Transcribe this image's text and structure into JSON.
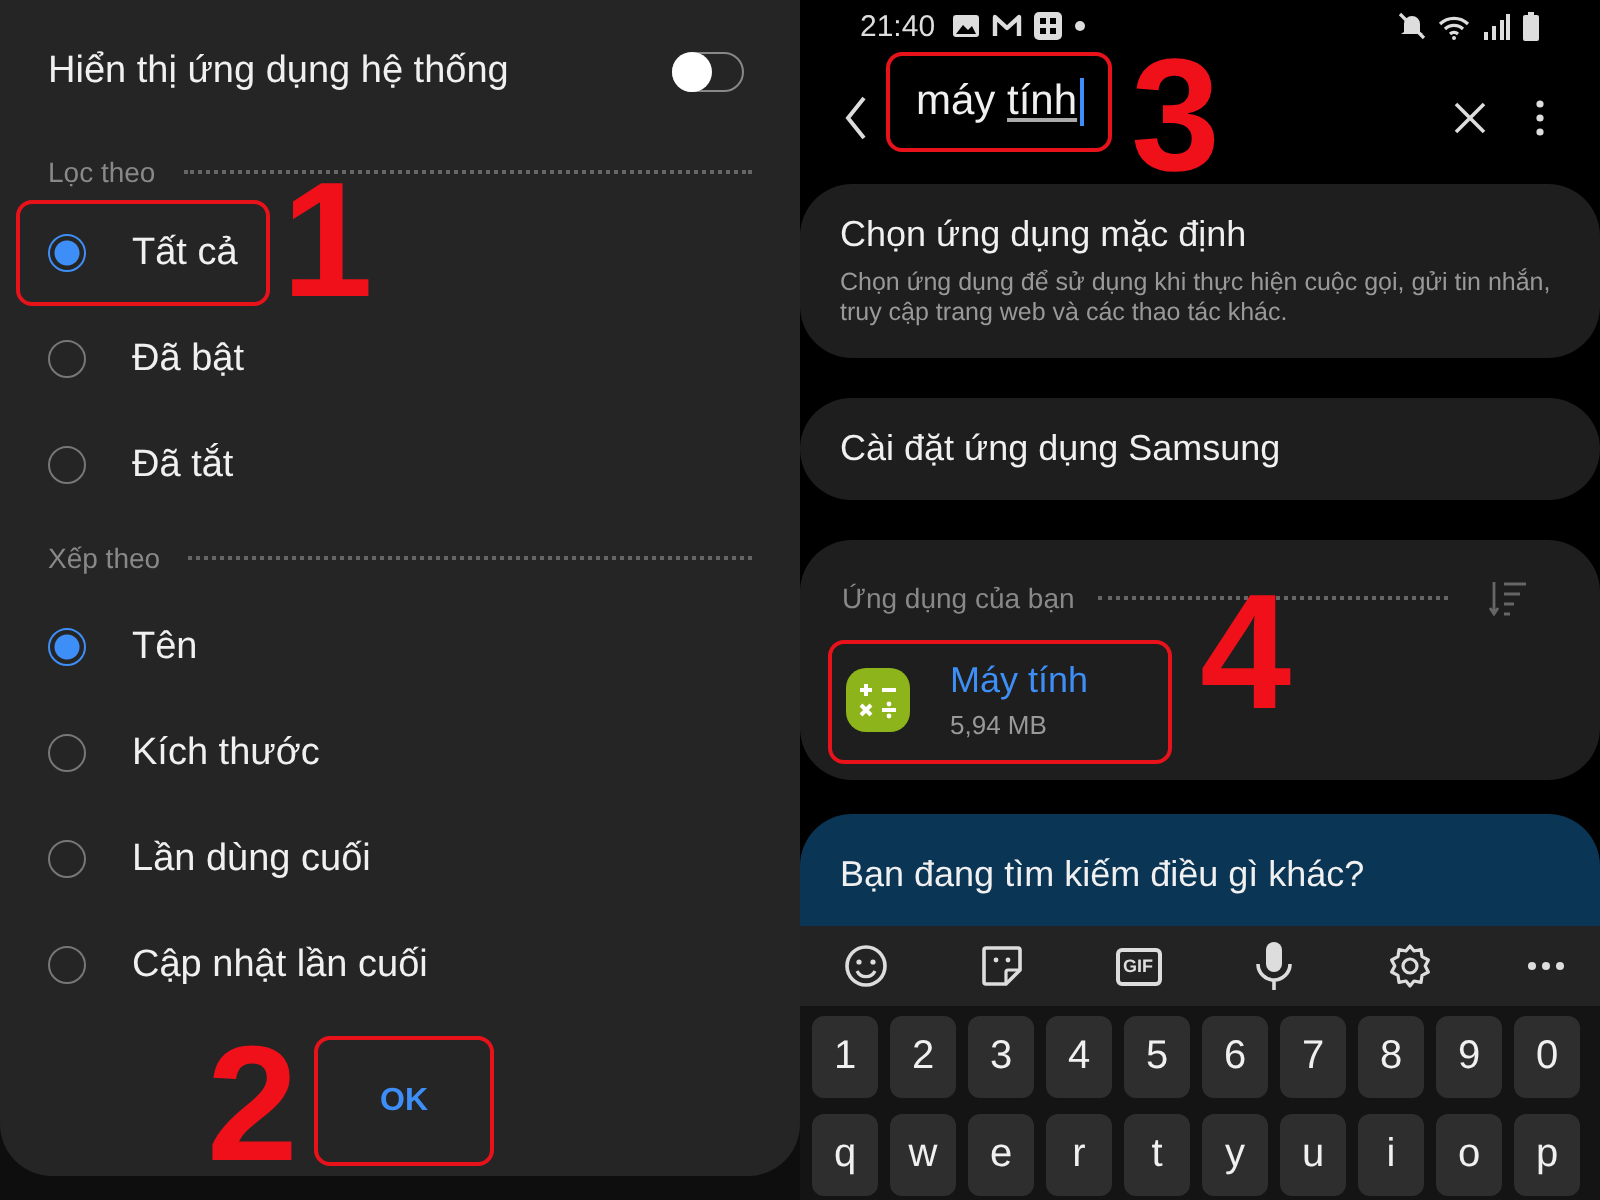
{
  "left": {
    "system_apps": {
      "label": "Hiển thị ứng dụng hệ thống",
      "on": false
    },
    "filter": {
      "title": "Lọc theo",
      "options": [
        {
          "label": "Tất cả",
          "selected": true,
          "callout": "1"
        },
        {
          "label": "Đã bật",
          "selected": false
        },
        {
          "label": "Đã tắt",
          "selected": false
        }
      ]
    },
    "sort": {
      "title": "Xếp theo",
      "options": [
        {
          "label": "Tên",
          "selected": true
        },
        {
          "label": "Kích thước",
          "selected": false
        },
        {
          "label": "Lần dùng cuối",
          "selected": false
        },
        {
          "label": "Cập nhật lần cuối",
          "selected": false
        }
      ]
    },
    "ok_button": {
      "label": "OK",
      "callout": "2"
    }
  },
  "right": {
    "status_bar": {
      "time": "21:40"
    },
    "search": {
      "value": "máy",
      "composing": "tính",
      "callout": "3"
    },
    "results": [
      {
        "title": "Chọn ứng dụng mặc định",
        "description": "Chọn ứng dụng để sử dụng khi thực hiện cuộc gọi, gửi tin nhắn, truy cập trang web và các thao tác khác."
      },
      {
        "title": "Cài đặt ứng dụng Samsung"
      }
    ],
    "apps_section": {
      "title": "Ứng dụng của bạn",
      "apps": [
        {
          "name": "Máy tính",
          "size": "5,94 MB",
          "callout": "4"
        }
      ]
    },
    "suggestion": "Bạn đang tìm kiếm điều gì khác?",
    "keyboard": {
      "gif_label": "GIF",
      "rows": [
        [
          "1",
          "2",
          "3",
          "4",
          "5",
          "6",
          "7",
          "8",
          "9",
          "0"
        ],
        [
          "q",
          "w",
          "e",
          "r",
          "t",
          "y",
          "u",
          "i",
          "o",
          "p"
        ]
      ]
    }
  }
}
